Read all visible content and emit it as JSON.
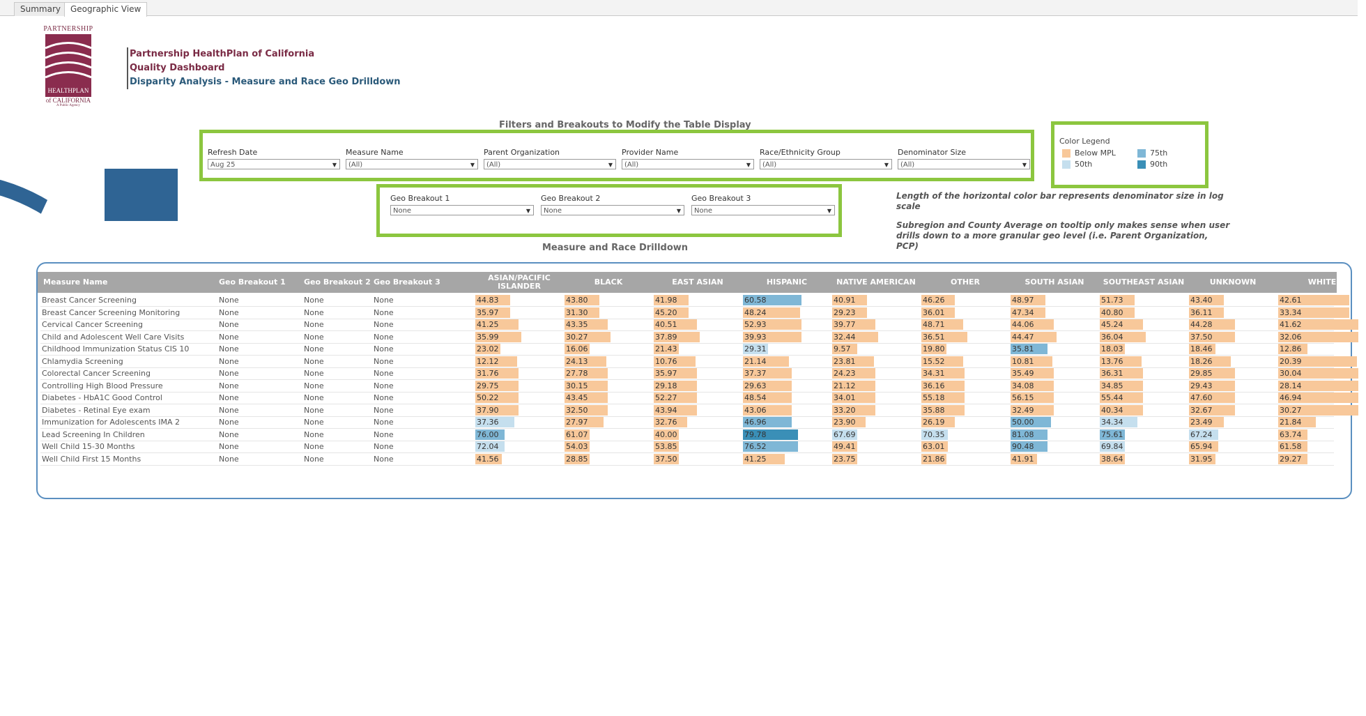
{
  "tabs": [
    {
      "label": "Summary",
      "active": false
    },
    {
      "label": "Geographic View",
      "active": true
    }
  ],
  "logo": {
    "top_text": "PARTNERSHIP",
    "bottom_text": "HEALTHPLAN",
    "sub_text": "of CALIFORNIA",
    "tagline": "A Public Agency"
  },
  "header": {
    "line1": "Partnership HealthPlan of California",
    "line2": "Quality Dashboard",
    "line3": "Disparity Analysis - Measure and Race Geo Drilldown"
  },
  "filters_title": "Filters and Breakouts to Modify the Table Display",
  "filters": [
    {
      "label": "Refresh Date",
      "value": "Aug 25"
    },
    {
      "label": "Measure Name",
      "value": "(All)"
    },
    {
      "label": "Parent Organization",
      "value": "(All)"
    },
    {
      "label": "Provider Name",
      "value": "(All)"
    },
    {
      "label": "Race/Ethnicity Group",
      "value": "(All)"
    },
    {
      "label": "Denominator Size",
      "value": "(All)"
    }
  ],
  "breakouts": [
    {
      "label": "Geo Breakout 1",
      "value": "None"
    },
    {
      "label": "Geo Breakout 2",
      "value": "None"
    },
    {
      "label": "Geo Breakout 3",
      "value": "None"
    }
  ],
  "legend": {
    "title": "Color Legend",
    "items": [
      {
        "label": "Below MPL",
        "color": "#f8c89a"
      },
      {
        "label": "75th",
        "color": "#7fb7d6"
      },
      {
        "label": "50th",
        "color": "#c5dfee"
      },
      {
        "label": "90th",
        "color": "#3a8fb7"
      }
    ]
  },
  "notes": {
    "note1": "Length of the horizontal color bar represents denominator size in log scale",
    "note2": "Subregion and County Average on tooltip only makes sense when user drills down to a more granular geo level (i.e. Parent Organization, PCP)"
  },
  "table_title": "Measure and Race Drilldown",
  "table": {
    "headers": [
      "Measure Name",
      "Geo Breakout 1",
      "Geo Breakout 2",
      "Geo Breakout 3",
      "ASIAN/PACIFIC ISLANDER",
      "BLACK",
      "EAST ASIAN",
      "HISPANIC",
      "NATIVE AMERICAN",
      "OTHER",
      "SOUTH ASIAN",
      "SOUTHEAST ASIAN",
      "UNKNOWN",
      "WHITE"
    ],
    "rows": [
      {
        "measure": "Breast Cancer Screening",
        "g1": "None",
        "g2": "None",
        "g3": "None",
        "values": [
          "44.83",
          "43.80",
          "41.98",
          "60.58",
          "40.91",
          "46.26",
          "48.97",
          "51.73",
          "43.40",
          "42.61"
        ]
      },
      {
        "measure": "Breast Cancer Screening Monitoring",
        "g1": "None",
        "g2": "None",
        "g3": "None",
        "values": [
          "35.97",
          "31.30",
          "45.20",
          "48.24",
          "29.23",
          "36.01",
          "47.34",
          "40.80",
          "36.11",
          "33.34"
        ]
      },
      {
        "measure": "Cervical Cancer Screening",
        "g1": "None",
        "g2": "None",
        "g3": "None",
        "values": [
          "41.25",
          "43.35",
          "40.51",
          "52.93",
          "39.77",
          "48.71",
          "44.06",
          "45.24",
          "44.28",
          "41.62"
        ]
      },
      {
        "measure": "Child and Adolescent Well Care Visits",
        "g1": "None",
        "g2": "None",
        "g3": "None",
        "values": [
          "35.99",
          "30.27",
          "37.89",
          "39.93",
          "32.44",
          "36.51",
          "44.47",
          "36.04",
          "37.50",
          "32.06"
        ]
      },
      {
        "measure": "Childhood Immunization Status CIS 10",
        "g1": "None",
        "g2": "None",
        "g3": "None",
        "values": [
          "23.02",
          "16.06",
          "21.43",
          "29.31",
          "9.57",
          "19.80",
          "35.81",
          "18.03",
          "18.46",
          "12.86"
        ]
      },
      {
        "measure": "Chlamydia Screening",
        "g1": "None",
        "g2": "None",
        "g3": "None",
        "values": [
          "12.12",
          "24.13",
          "10.76",
          "21.14",
          "23.81",
          "15.52",
          "10.81",
          "13.76",
          "18.26",
          "20.39"
        ]
      },
      {
        "measure": "Colorectal Cancer Screening",
        "g1": "None",
        "g2": "None",
        "g3": "None",
        "values": [
          "31.76",
          "27.78",
          "35.97",
          "37.37",
          "24.23",
          "34.31",
          "35.49",
          "36.31",
          "29.85",
          "30.04"
        ]
      },
      {
        "measure": "Controlling High Blood Pressure",
        "g1": "None",
        "g2": "None",
        "g3": "None",
        "values": [
          "29.75",
          "30.15",
          "29.18",
          "29.63",
          "21.12",
          "36.16",
          "34.08",
          "34.85",
          "29.43",
          "28.14"
        ]
      },
      {
        "measure": "Diabetes - HbA1C Good Control",
        "g1": "None",
        "g2": "None",
        "g3": "None",
        "values": [
          "50.22",
          "43.45",
          "52.27",
          "48.54",
          "34.01",
          "55.18",
          "56.15",
          "55.44",
          "47.60",
          "46.94"
        ]
      },
      {
        "measure": "Diabetes - Retinal Eye exam",
        "g1": "None",
        "g2": "None",
        "g3": "None",
        "values": [
          "37.90",
          "32.50",
          "43.94",
          "43.06",
          "33.20",
          "35.88",
          "32.49",
          "40.34",
          "32.67",
          "30.27"
        ]
      },
      {
        "measure": "Immunization for Adolescents IMA 2",
        "g1": "None",
        "g2": "None",
        "g3": "None",
        "values": [
          "37.36",
          "27.97",
          "32.76",
          "46.96",
          "23.90",
          "26.19",
          "50.00",
          "34.34",
          "23.49",
          "21.84"
        ]
      },
      {
        "measure": "Lead Screening In Children",
        "g1": "None",
        "g2": "None",
        "g3": "None",
        "values": [
          "76.00",
          "61.07",
          "40.00",
          "79.78",
          "67.69",
          "70.35",
          "81.08",
          "75.61",
          "67.24",
          "63.74"
        ]
      },
      {
        "measure": "Well Child 15-30 Months",
        "g1": "None",
        "g2": "None",
        "g3": "None",
        "values": [
          "72.04",
          "54.03",
          "53.85",
          "76.52",
          "49.41",
          "63.01",
          "90.48",
          "69.84",
          "65.94",
          "61.58"
        ]
      },
      {
        "measure": "Well Child First 15 Months",
        "g1": "None",
        "g2": "None",
        "g3": "None",
        "values": [
          "41.56",
          "28.85",
          "37.50",
          "41.25",
          "23.75",
          "21.86",
          "41.91",
          "38.64",
          "31.95",
          "29.27"
        ]
      }
    ],
    "colors": [
      [
        "o",
        "o",
        "o",
        "m",
        "o",
        "o",
        "o",
        "o",
        "o",
        "o"
      ],
      [
        "o",
        "o",
        "o",
        "o",
        "o",
        "o",
        "o",
        "o",
        "o",
        "o"
      ],
      [
        "o",
        "o",
        "o",
        "o",
        "o",
        "o",
        "o",
        "o",
        "o",
        "o"
      ],
      [
        "o",
        "o",
        "o",
        "o",
        "o",
        "o",
        "o",
        "o",
        "o",
        "o"
      ],
      [
        "o",
        "o",
        "o",
        "l",
        "o",
        "o",
        "m",
        "o",
        "o",
        "o"
      ],
      [
        "o",
        "o",
        "o",
        "o",
        "o",
        "o",
        "o",
        "o",
        "o",
        "o"
      ],
      [
        "o",
        "o",
        "o",
        "o",
        "o",
        "o",
        "o",
        "o",
        "o",
        "o"
      ],
      [
        "o",
        "o",
        "o",
        "o",
        "o",
        "o",
        "o",
        "o",
        "o",
        "o"
      ],
      [
        "o",
        "o",
        "o",
        "o",
        "o",
        "o",
        "o",
        "o",
        "o",
        "o"
      ],
      [
        "o",
        "o",
        "o",
        "o",
        "o",
        "o",
        "o",
        "o",
        "o",
        "o"
      ],
      [
        "l",
        "o",
        "o",
        "m",
        "o",
        "o",
        "m",
        "l",
        "o",
        "o"
      ],
      [
        "m",
        "o",
        "o",
        "d",
        "l",
        "l",
        "m",
        "m",
        "l",
        "o"
      ],
      [
        "l",
        "o",
        "o",
        "m",
        "o",
        "o",
        "m",
        "l",
        "o",
        "o"
      ],
      [
        "o",
        "o",
        "o",
        "o",
        "o",
        "o",
        "o",
        "o",
        "o",
        "o"
      ]
    ],
    "bar_fraction": [
      [
        0.42,
        0.42,
        0.42,
        0.7,
        0.42,
        0.4,
        0.42,
        0.42,
        0.42,
        0.85
      ],
      [
        0.42,
        0.42,
        0.42,
        0.68,
        0.42,
        0.4,
        0.42,
        0.42,
        0.42,
        0.85
      ],
      [
        0.52,
        0.52,
        0.52,
        0.7,
        0.52,
        0.5,
        0.52,
        0.52,
        0.55,
        0.96
      ],
      [
        0.55,
        0.55,
        0.55,
        0.7,
        0.55,
        0.55,
        0.55,
        0.55,
        0.55,
        0.96
      ],
      [
        0.3,
        0.3,
        0.3,
        0.3,
        0.3,
        0.3,
        0.44,
        0.3,
        0.32,
        0.35
      ],
      [
        0.5,
        0.5,
        0.5,
        0.55,
        0.5,
        0.5,
        0.5,
        0.5,
        0.5,
        0.94
      ],
      [
        0.52,
        0.52,
        0.52,
        0.58,
        0.52,
        0.52,
        0.52,
        0.52,
        0.55,
        0.96
      ],
      [
        0.52,
        0.52,
        0.52,
        0.58,
        0.52,
        0.52,
        0.52,
        0.52,
        0.55,
        0.96
      ],
      [
        0.52,
        0.52,
        0.52,
        0.58,
        0.52,
        0.52,
        0.52,
        0.52,
        0.55,
        0.96
      ],
      [
        0.52,
        0.52,
        0.52,
        0.58,
        0.52,
        0.52,
        0.52,
        0.52,
        0.55,
        0.96
      ],
      [
        0.47,
        0.47,
        0.4,
        0.58,
        0.4,
        0.4,
        0.48,
        0.45,
        0.42,
        0.45
      ],
      [
        0.35,
        0.3,
        0.3,
        0.66,
        0.3,
        0.32,
        0.44,
        0.3,
        0.35,
        0.35
      ],
      [
        0.35,
        0.3,
        0.3,
        0.66,
        0.3,
        0.32,
        0.44,
        0.3,
        0.35,
        0.35
      ],
      [
        0.32,
        0.3,
        0.3,
        0.5,
        0.3,
        0.3,
        0.32,
        0.3,
        0.32,
        0.35
      ]
    ]
  }
}
